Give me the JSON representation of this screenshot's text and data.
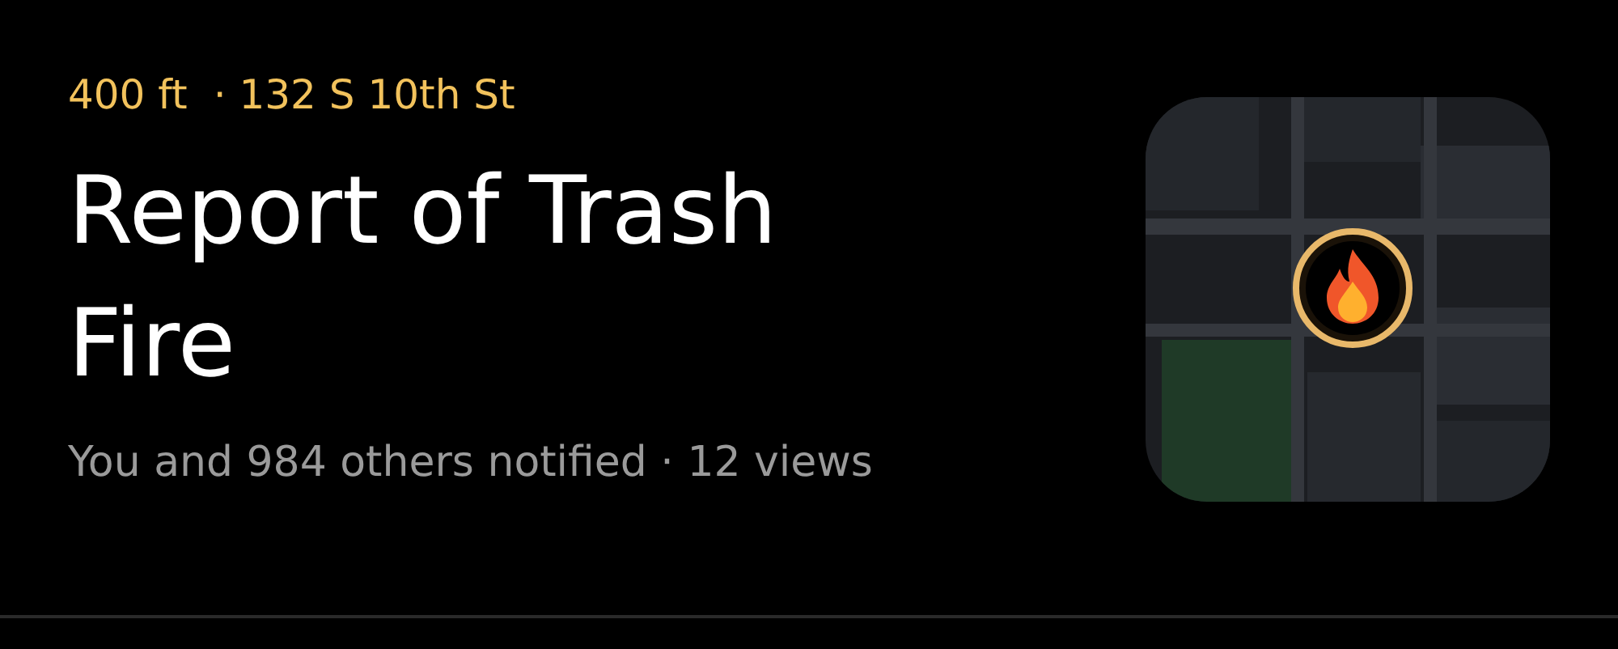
{
  "meta": {
    "distance": "400 ft",
    "address": "· 132 S 10th St"
  },
  "title": "Report of Trash Fire",
  "stats": "You and 984 others notified · 12 views"
}
